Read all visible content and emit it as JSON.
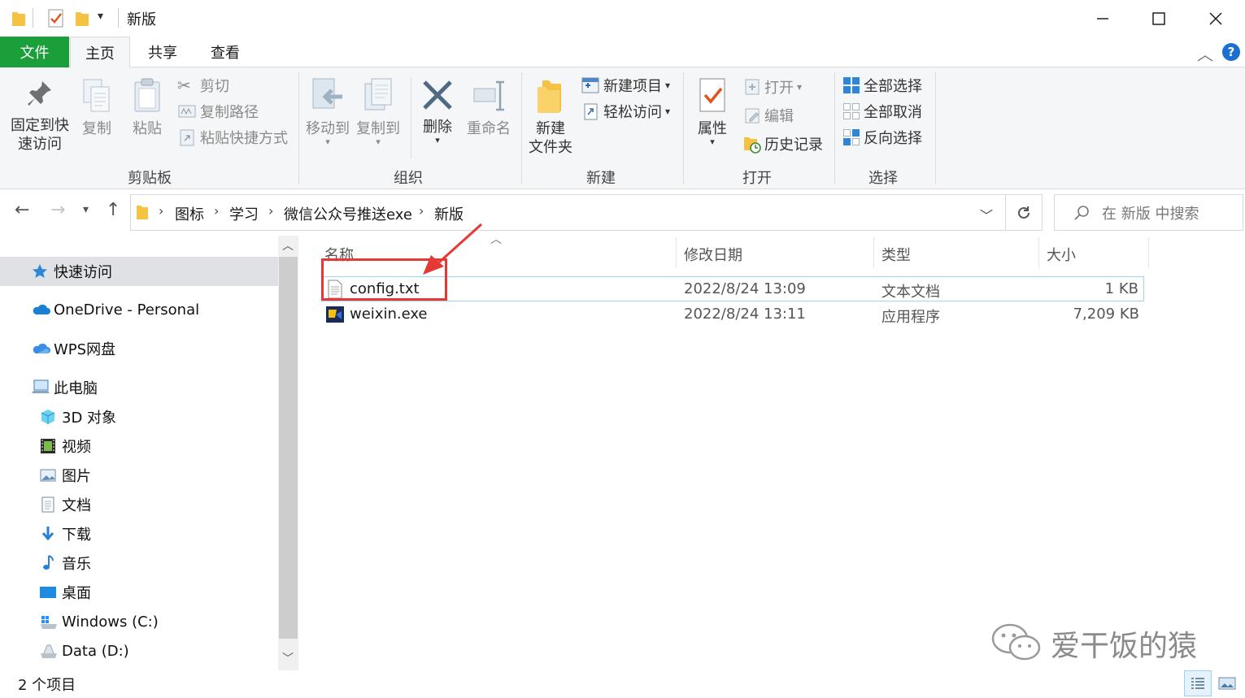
{
  "window": {
    "title": "新版",
    "controls": [
      "minimize-icon",
      "maximize-icon",
      "close-icon"
    ]
  },
  "ribbon_tabs": [
    "文件",
    "主页",
    "共享",
    "查看"
  ],
  "ribbon": {
    "clipboard": {
      "pin_line1": "固定到快",
      "pin_line2": "速访问",
      "copy": "复制",
      "paste": "粘贴",
      "cut": "剪切",
      "copy_path": "复制路径",
      "paste_shortcut": "粘贴快捷方式",
      "label": "剪贴板"
    },
    "organize": {
      "move_to": "移动到",
      "copy_to": "复制到",
      "delete": "删除",
      "rename": "重命名",
      "label": "组织"
    },
    "new": {
      "new_folder_line1": "新建",
      "new_folder_line2": "文件夹",
      "new_item": "新建项目",
      "easy_access": "轻松访问",
      "label": "新建"
    },
    "open": {
      "properties": "属性",
      "open": "打开",
      "edit": "编辑",
      "history": "历史记录",
      "label": "打开"
    },
    "select": {
      "select_all": "全部选择",
      "select_none": "全部取消",
      "invert": "反向选择",
      "label": "选择"
    }
  },
  "address": {
    "crumbs": [
      "图标",
      "学习",
      "微信公众号推送exe",
      "新版"
    ],
    "search_placeholder": "在 新版 中搜索"
  },
  "nav": {
    "quick_access": "快速访问",
    "onedrive": "OneDrive - Personal",
    "wps": "WPS网盘",
    "this_pc": "此电脑",
    "items": [
      "3D 对象",
      "视频",
      "图片",
      "文档",
      "下载",
      "音乐",
      "桌面",
      "Windows (C:)",
      "Data (D:)"
    ]
  },
  "columns": {
    "name": "名称",
    "modified": "修改日期",
    "type": "类型",
    "size": "大小"
  },
  "files": [
    {
      "name": "config.txt",
      "modified": "2022/8/24 13:09",
      "type": "文本文档",
      "size": "1 KB"
    },
    {
      "name": "weixin.exe",
      "modified": "2022/8/24 13:11",
      "type": "应用程序",
      "size": "7,209 KB"
    }
  ],
  "status": {
    "count": "2 个项目"
  },
  "watermark": "爱干饭的猿",
  "colors": {
    "file_tab": "#1a9f3a",
    "annotation": "#e53935",
    "selection_border": "#99d1ff",
    "folder": "#f5c242"
  }
}
